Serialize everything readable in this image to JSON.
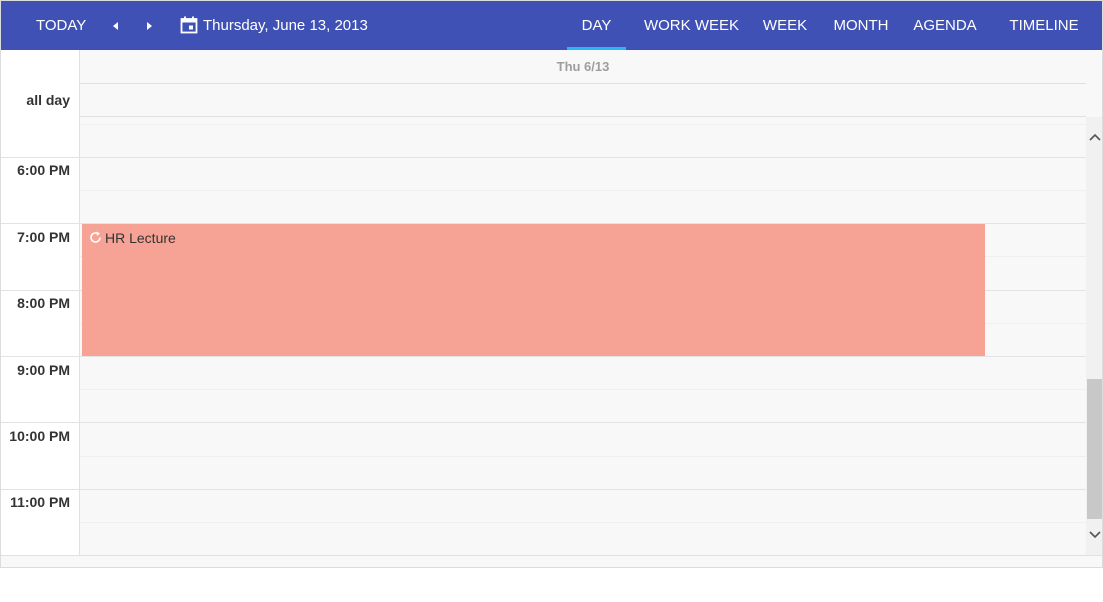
{
  "toolbar": {
    "today_label": "TODAY",
    "prev_icon": "chevron-left-icon",
    "next_icon": "chevron-right-icon",
    "calendar_icon": "calendar-icon",
    "current_date": "Thursday, June 13, 2013",
    "views": [
      {
        "label": "DAY",
        "active": true
      },
      {
        "label": "WORK WEEK",
        "active": false
      },
      {
        "label": "WEEK",
        "active": false
      },
      {
        "label": "MONTH",
        "active": false
      },
      {
        "label": "AGENDA",
        "active": false
      },
      {
        "label": "TIMELINE",
        "active": false
      }
    ]
  },
  "header": {
    "day_label": "Thu 6/13",
    "all_day_label": "all day"
  },
  "times": [
    "6:00 PM",
    "7:00 PM",
    "8:00 PM",
    "9:00 PM",
    "10:00 PM",
    "11:00 PM"
  ],
  "appointment": {
    "subject": "HR Lecture",
    "icon": "recurrence-icon",
    "color": "#f6a395"
  },
  "colors": {
    "toolbar_bg": "#3f51b5",
    "active_view_underline": "#29b6f6"
  }
}
